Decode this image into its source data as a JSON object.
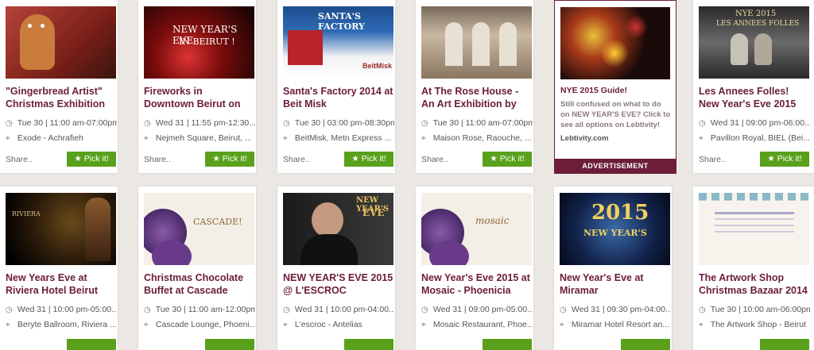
{
  "cards_row1": [
    {
      "title": "\"Gingerbread Artist\" Christmas Exhibition by",
      "datetime": "Tue 30 | 11:00 am-07:00pm",
      "location": "Exode - Achrafieh",
      "share": "Share..",
      "pick": "Pick it!",
      "thumb_text": "",
      "thumb_text2": ""
    },
    {
      "title": "Fireworks in Downtown Beirut on New Year's",
      "datetime": "Wed 31 | 11:55 pm-12:30...",
      "location": "Nejmeh Square, Beirut, ...",
      "share": "Share..",
      "pick": "Pick it!",
      "thumb_text": "NEW YEAR'S EVE",
      "thumb_text2": "IN BEIRUT !"
    },
    {
      "title": "Santa's Factory 2014 at Beit Misk",
      "datetime": "Tue 30 | 03:00 pm-08:30pm",
      "location": "BeitMisk, Metn Express ...",
      "share": "Share..",
      "pick": "Pick it!",
      "thumb_text": "SANTA'S FACTORY",
      "thumb_text2": "BeitMisk"
    },
    {
      "title": "At The Rose House - An Art Exhibition by Tom",
      "datetime": "Tue 30 | 11:00 am-07:00pm",
      "location": "Maison Rose, Raouche, ...",
      "share": "Share..",
      "pick": "Pick it!",
      "thumb_text": "",
      "thumb_text2": ""
    }
  ],
  "ad": {
    "title": "NYE 2015 Guide!",
    "text": "Still confused on what to do on NEW YEAR'S EVE? Click to see all options on Lebtivity!",
    "link": "Lebtivity.com",
    "label": "ADVERTISEMENT"
  },
  "card_row1_last": {
    "title": "Les Annees Folles! New Year's Eve 2015",
    "datetime": "Wed 31 | 09:00 pm-06:00...",
    "location": "Pavillon Royal, BIEL (Bei...",
    "share": "Share..",
    "pick": "Pick it!",
    "thumb_text": "NYE 2015",
    "thumb_text2": "LES ANNEES FOLLES"
  },
  "cards_row2": [
    {
      "title": "New Years Eve at Riviera Hotel Beirut",
      "datetime": "Wed 31 | 10:00 pm-05:00...",
      "location": "Beryte Ballroom, Riviera ...",
      "thumb_text": "RIVIERA",
      "thumb_text2": ""
    },
    {
      "title": "Christmas Chocolate Buffet at Cascade",
      "datetime": "Tue 30 | 11:00 am-12:00pm",
      "location": "Cascade Lounge, Phoeni...",
      "thumb_text": "CASCADE!",
      "thumb_text2": ""
    },
    {
      "title": "NEW YEAR'S EVE 2015 @ L'ESCROC",
      "datetime": "Wed 31 | 10:00 pm-04:00...",
      "location": "L'escroc - Antelias",
      "thumb_text": "NEW YEAR'S",
      "thumb_text2": "EVE"
    },
    {
      "title": "New Year's Eve 2015 at Mosaic - Phoenicia",
      "datetime": "Wed 31 | 09:00 pm-05:00...",
      "location": "Mosaic Restaurant, Phoe...",
      "thumb_text": "mosaic",
      "thumb_text2": ""
    },
    {
      "title": "New Year's Eve at Miramar",
      "datetime": "Wed 31 | 09:30 pm-04:00...",
      "location": "Miramar Hotel Resort an...",
      "thumb_text": "2015",
      "thumb_text2": "NEW YEAR'S"
    },
    {
      "title": "The Artwork Shop Christmas Bazaar 2014",
      "datetime": "Tue 30 | 10:00 am-06:00pm",
      "location": "The Artwork Shop - Beirut",
      "thumb_text": "",
      "thumb_text2": ""
    }
  ],
  "icons": {
    "clock": "clock-icon",
    "pin": "map-pin-icon",
    "star": "star-icon"
  },
  "colors": {
    "title": "#6b1d3a",
    "button": "#59a11b",
    "background": "#ebe8e3"
  }
}
